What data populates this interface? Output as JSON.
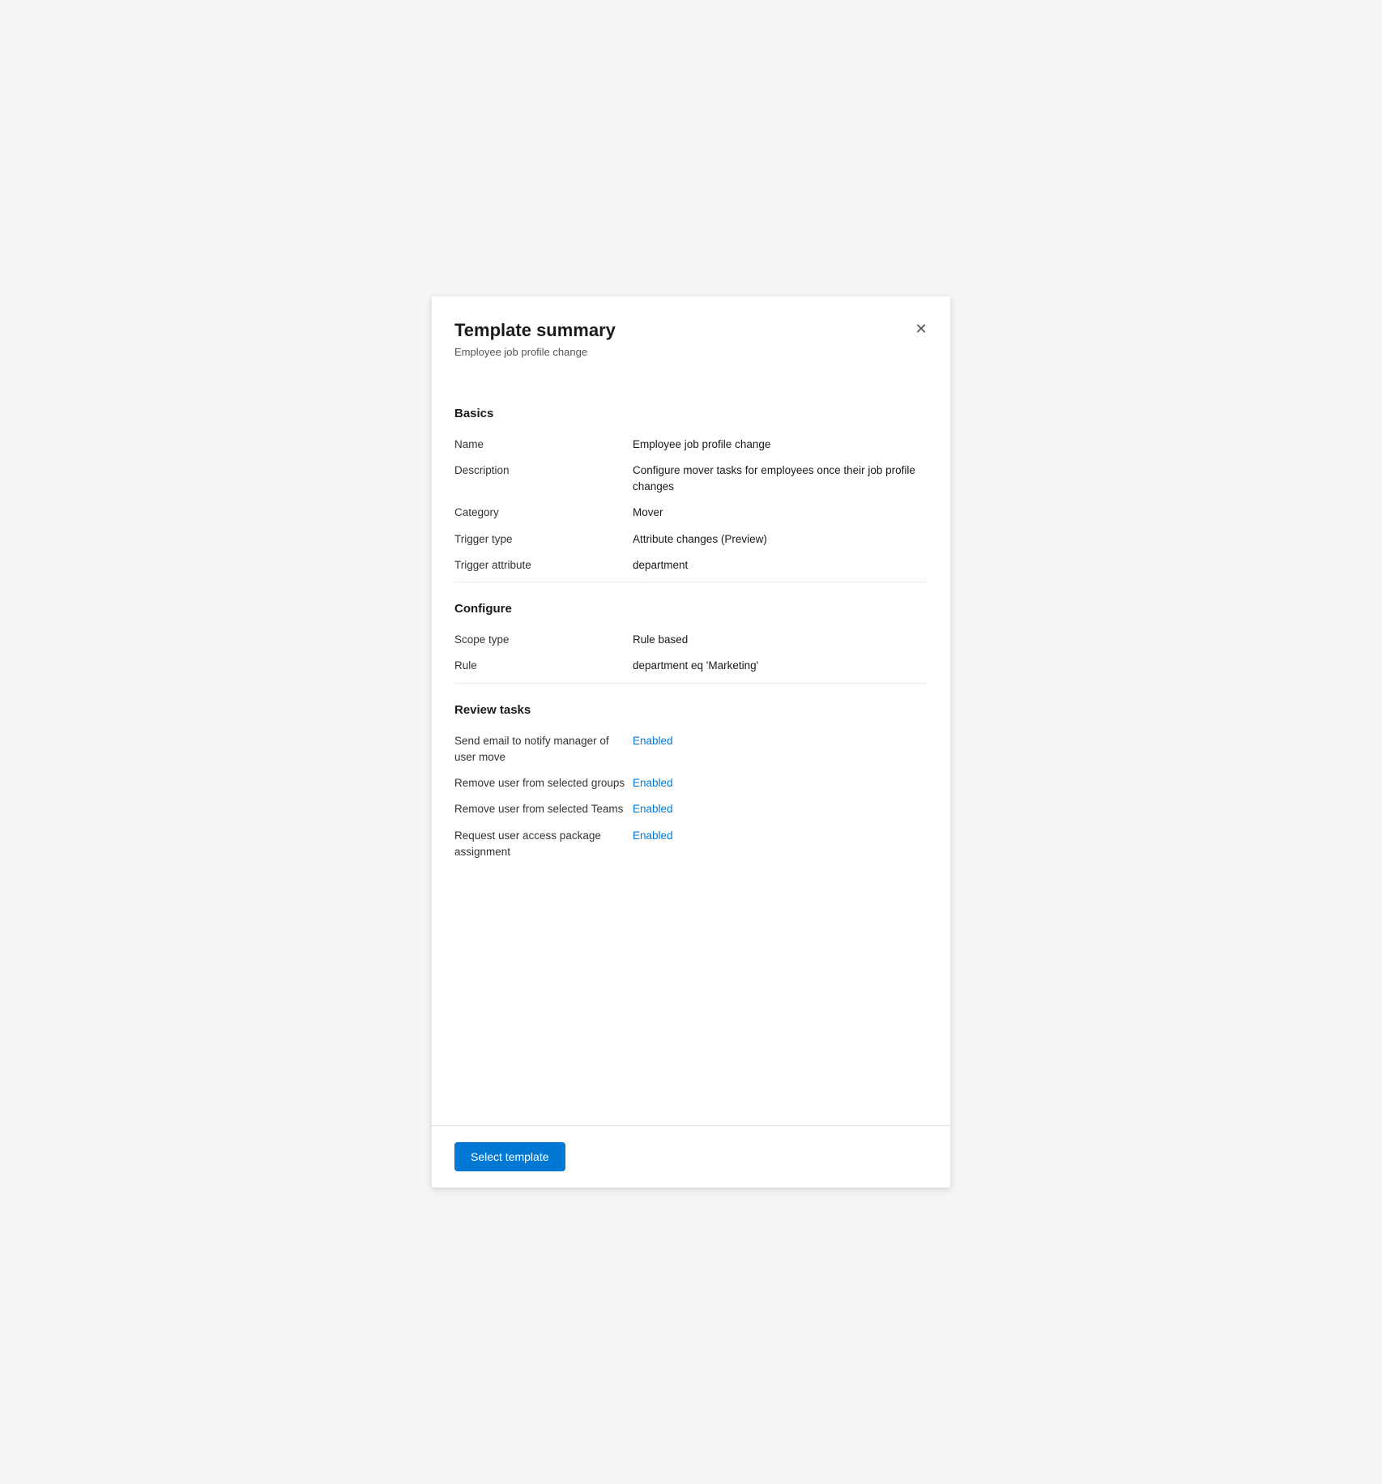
{
  "header": {
    "title": "Template summary",
    "subtitle": "Employee job profile change",
    "close_label": "×"
  },
  "sections": [
    {
      "id": "basics",
      "title": "Basics",
      "fields": [
        {
          "label": "Name",
          "value": "Employee job profile change",
          "enabled": false
        },
        {
          "label": "Description",
          "value": "Configure mover tasks for employees once their job profile changes",
          "enabled": false
        },
        {
          "label": "Category",
          "value": "Mover",
          "enabled": false
        },
        {
          "label": "Trigger type",
          "value": "Attribute changes (Preview)",
          "enabled": false
        },
        {
          "label": "Trigger attribute",
          "value": "department",
          "enabled": false
        }
      ]
    },
    {
      "id": "configure",
      "title": "Configure",
      "fields": [
        {
          "label": "Scope type",
          "value": "Rule based",
          "enabled": false
        },
        {
          "label": "Rule",
          "value": "department eq 'Marketing'",
          "enabled": false
        }
      ]
    },
    {
      "id": "review-tasks",
      "title": "Review tasks",
      "fields": [
        {
          "label": "Send email to notify manager of user move",
          "value": "Enabled",
          "enabled": true
        },
        {
          "label": "Remove user from selected groups",
          "value": "Enabled",
          "enabled": true
        },
        {
          "label": "Remove user from selected Teams",
          "value": "Enabled",
          "enabled": true
        },
        {
          "label": "Request user access package assignment",
          "value": "Enabled",
          "enabled": true
        }
      ]
    }
  ],
  "footer": {
    "select_template_label": "Select template"
  }
}
